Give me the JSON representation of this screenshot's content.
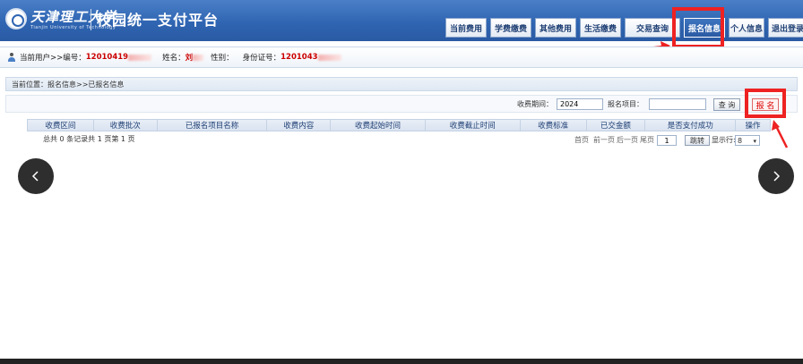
{
  "header": {
    "university_name": "天津理工大学",
    "university_sub": "Tianjin University of Technology",
    "platform_title": "校园统一支付平台",
    "nav": [
      {
        "label": "当前费用"
      },
      {
        "label": "学费缴费"
      },
      {
        "label": "其他费用"
      },
      {
        "label": "生活缴费"
      },
      {
        "label": "交易查询"
      },
      {
        "label": "报名信息",
        "active": true
      },
      {
        "label": "个人信息"
      },
      {
        "label": "退出登录"
      }
    ]
  },
  "user_bar": {
    "current_user_label": "当前用户>>编号：",
    "user_id": "12010419",
    "name_label": "姓名：",
    "name_value": "刘",
    "gender_label": "性别：",
    "id_card_label": "身份证号：",
    "id_card_value": "1201043"
  },
  "location": {
    "text": "当前位置：报名信息>>已报名信息"
  },
  "filter": {
    "period_label": "收费期间：",
    "period_value": "2024",
    "project_label": "报名项目：",
    "project_value": "",
    "query_label": "查 询",
    "signup_label": "报 名"
  },
  "table": {
    "columns": [
      "收费区间",
      "收费批次",
      "已报名项目名称",
      "收费内容",
      "收费起始时间",
      "收费截止时间",
      "收费标准",
      "已交金额",
      "是否支付成功",
      "操作"
    ],
    "total_text": "总共 0 条记录共 1 页第 1 页"
  },
  "pager": {
    "first": "首页",
    "prev": "前一页",
    "next": "后一页",
    "last": "尾页",
    "page_value": "1",
    "jump_label": "跳转",
    "rows_label": "显示行:",
    "rows_value": "8"
  },
  "colors": {
    "header_blue": "#2f65b2",
    "highlight_red": "#ee2222"
  }
}
